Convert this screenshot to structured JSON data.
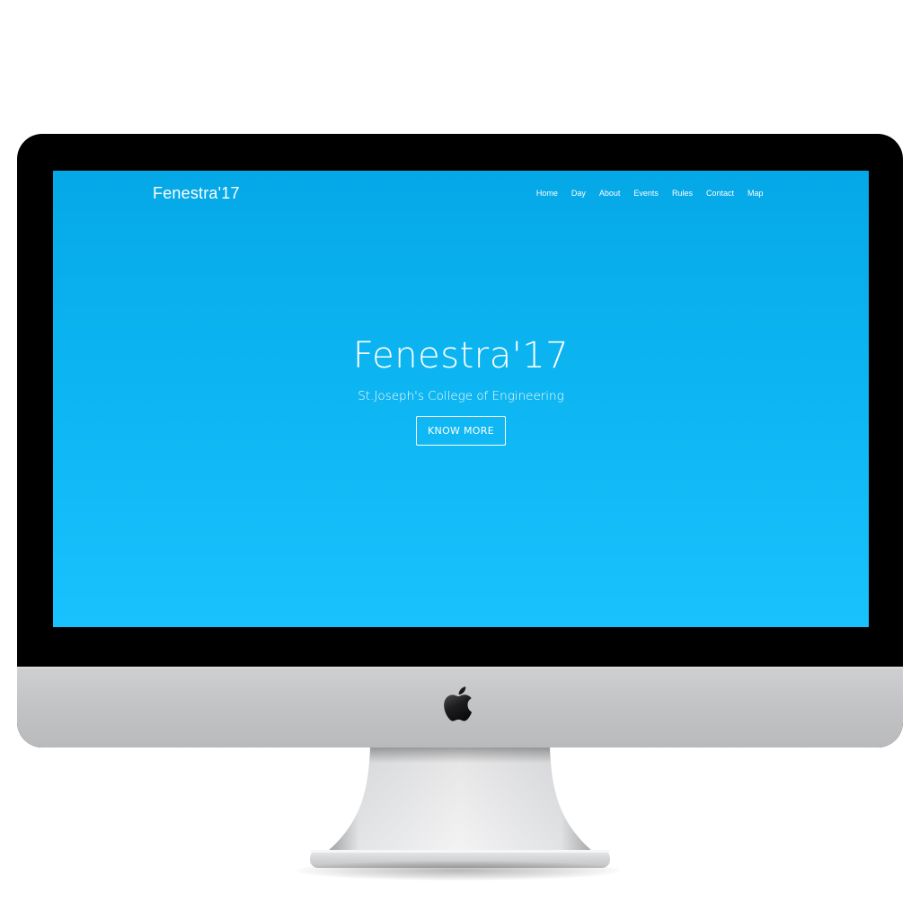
{
  "site": {
    "brand": "Fenestra'17",
    "nav_items": [
      {
        "label": "Home"
      },
      {
        "label": "Day"
      },
      {
        "label": "About"
      },
      {
        "label": "Events"
      },
      {
        "label": "Rules"
      },
      {
        "label": "Contact"
      },
      {
        "label": "Map"
      }
    ],
    "hero": {
      "title": "Fenestra'17",
      "subtitle": "St.Joseph's College of Engineering",
      "button_label": "KNOW MORE"
    }
  },
  "colors": {
    "screen_top": "#05a8e7",
    "screen_bottom": "#19c2fd",
    "text": "#ffffff",
    "bezel": "#000000",
    "chin": "#c6c7c9"
  },
  "icons": {
    "device_logo": "apple-logo-icon"
  }
}
